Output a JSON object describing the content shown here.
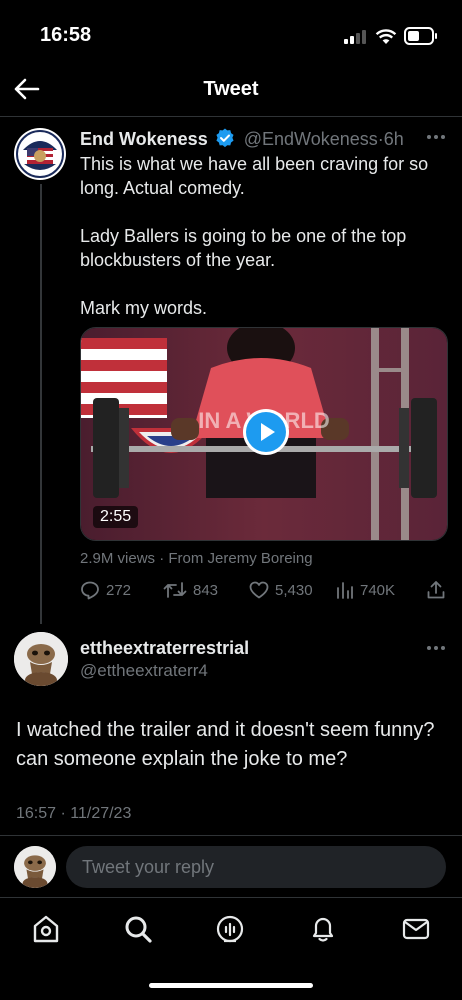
{
  "status_bar": {
    "time": "16:58"
  },
  "header": {
    "title": "Tweet",
    "back_icon": "back-arrow-icon"
  },
  "tweet": {
    "author_name": "End Wokeness",
    "verified": true,
    "handle": "@EndWokeness",
    "separator": "·",
    "age": "6h",
    "more_icon": "more-icon",
    "text": [
      "This is what we have all been craving for so long. Actual comedy.",
      "Lady Ballers is going to be one of the top blockbusters of the year.",
      "Mark my words."
    ],
    "video": {
      "duration": "2:55",
      "overlay_text": "IN A WORLD"
    },
    "video_meta": "2.9M views · From Jeremy Boreing",
    "actions": {
      "replies": "272",
      "retweets": "843",
      "likes": "5,430",
      "views": "740K"
    }
  },
  "reply": {
    "author_name": "ettheextraterrestrial",
    "handle": "@ettheextraterr4",
    "text": "I watched the trailer and it doesn't seem funny? can someone explain the joke to me?",
    "timestamp": "16:57 · 11/27/23"
  },
  "composer": {
    "placeholder": "Tweet your reply"
  },
  "colors": {
    "accent": "#1d9bf0",
    "background": "#000000",
    "muted": "#71767b"
  },
  "bottom_nav": [
    {
      "icon": "home-icon"
    },
    {
      "icon": "search-icon"
    },
    {
      "icon": "spaces-icon"
    },
    {
      "icon": "notifications-icon"
    },
    {
      "icon": "messages-icon"
    }
  ]
}
